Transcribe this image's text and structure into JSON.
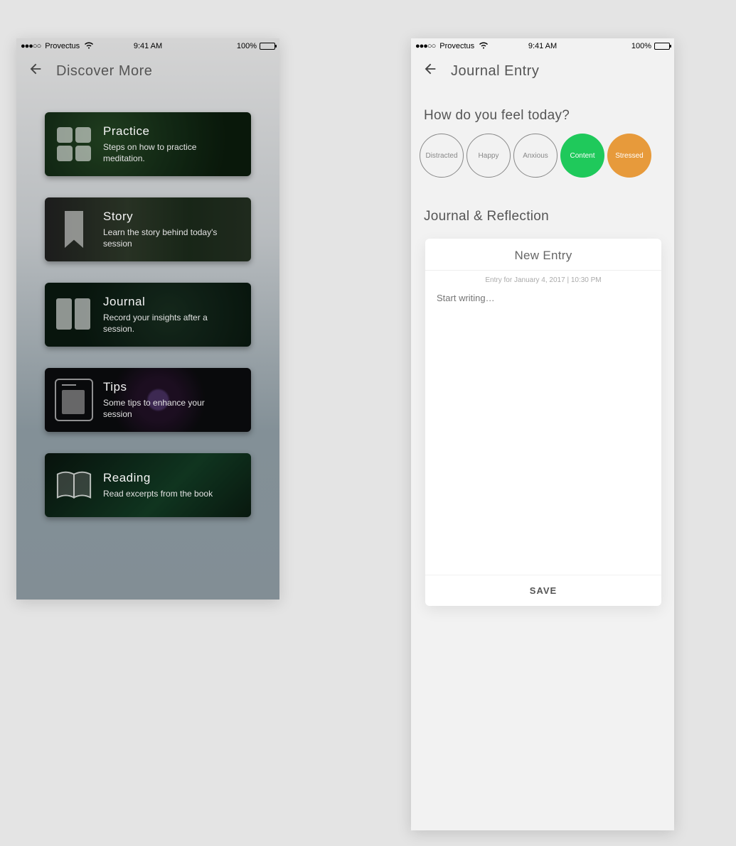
{
  "statusbar": {
    "carrier": "Provectus",
    "time": "9:41 AM",
    "battery_pct": "100%"
  },
  "left": {
    "title": "Discover More",
    "cards": [
      {
        "title": "Practice",
        "desc": "Steps on how to practice meditation."
      },
      {
        "title": "Story",
        "desc": "Learn the story behind today's session"
      },
      {
        "title": "Journal",
        "desc": "Record your insights after a session."
      },
      {
        "title": "Tips",
        "desc": "Some tips to enhance your session"
      },
      {
        "title": "Reading",
        "desc": "Read excerpts from the book"
      }
    ]
  },
  "right": {
    "title": "Journal Entry",
    "question": "How do you feel today?",
    "moods": [
      {
        "label": "Distracted"
      },
      {
        "label": "Happy"
      },
      {
        "label": "Anxious"
      },
      {
        "label": "Content"
      },
      {
        "label": "Stressed"
      }
    ],
    "section": "Journal & Reflection",
    "entry": {
      "heading": "New Entry",
      "meta": "Entry for January 4, 2017 | 10:30 PM",
      "placeholder": "Start writing…",
      "save": "SAVE"
    }
  }
}
